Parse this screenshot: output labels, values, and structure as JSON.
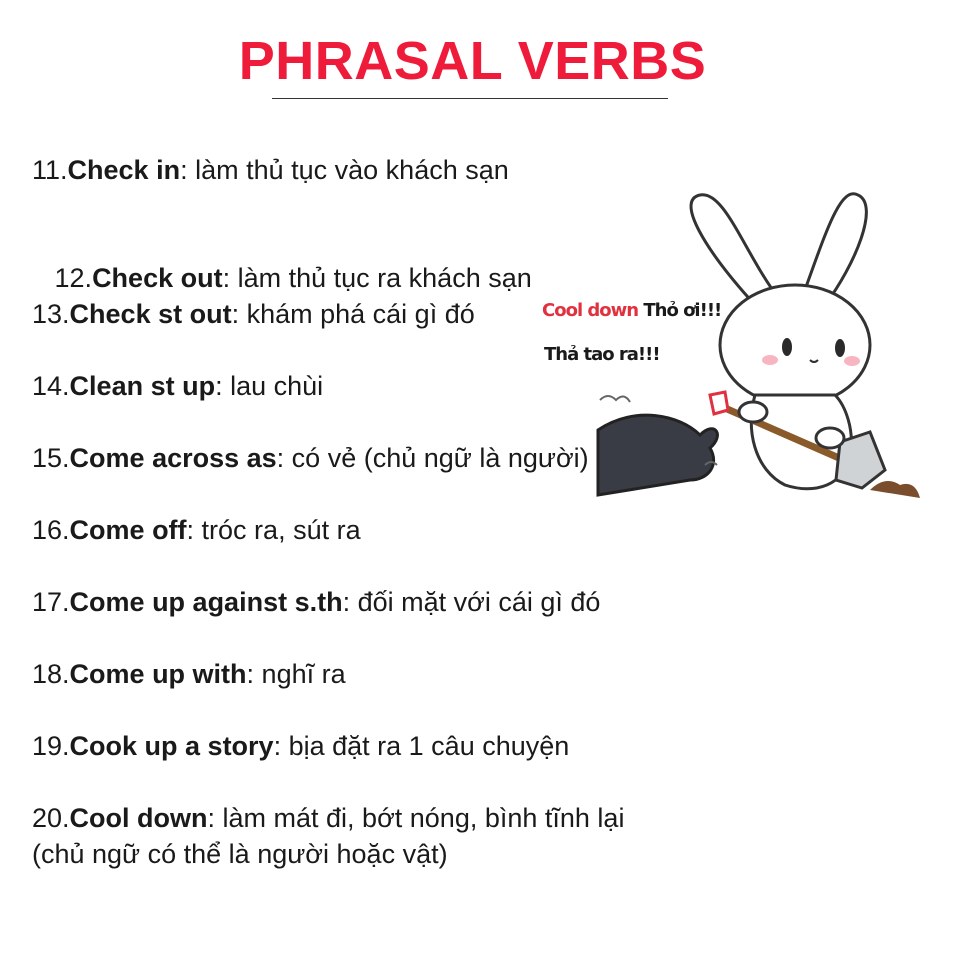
{
  "title": "PHRASAL VERBS",
  "entries": [
    {
      "num": "11.",
      "term": "Check in",
      "meaning": ": làm thủ tục vào khách sạn"
    },
    {
      "num": " 12.",
      "term": "Check out",
      "meaning": ": làm thủ tục ra khách sạn"
    },
    {
      "num": "13.",
      "term": "Check st out",
      "meaning": ": khám phá cái gì đó"
    },
    {
      "num": "14.",
      "term": "Clean st up",
      "meaning": ": lau chùi"
    },
    {
      "num": "15.",
      "term": "Come across as",
      "meaning": ": có vẻ (chủ ngữ là người)"
    },
    {
      "num": "16.",
      "term": "Come off",
      "meaning": ": tróc ra, sút ra"
    },
    {
      "num": "17.",
      "term": "Come up against s.th",
      "meaning": ": đối mặt với cái gì đó"
    },
    {
      "num": "18.",
      "term": "Come up with",
      "meaning": ": nghĩ ra"
    },
    {
      "num": "19.",
      "term": "Cook up a story",
      "meaning": ": bịa đặt ra 1 câu chuyện"
    },
    {
      "num": "20.",
      "term": "Cool down",
      "meaning": ": làm mát đi, bớt nóng, bình tĩnh lại",
      "continuation": "(chủ ngữ có thể là người hoặc vật)"
    }
  ],
  "illustration": {
    "speech_red": "Cool down",
    "speech_black": " Thỏ ơi!!!",
    "speech_line2": "Thả tao ra!!!"
  },
  "colors": {
    "title": "#ee1c3a",
    "speech_red": "#e0313e",
    "text": "#1a1a1a"
  }
}
